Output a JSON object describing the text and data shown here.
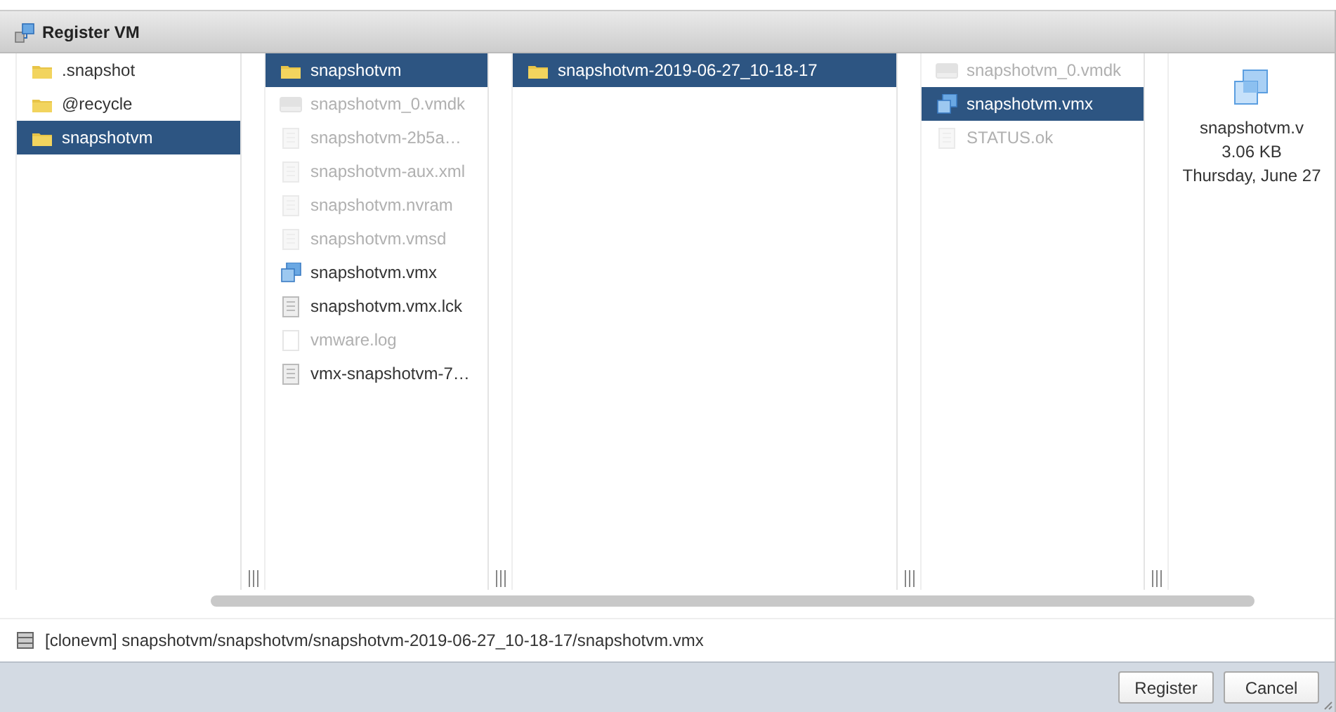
{
  "window": {
    "title": "Register VM"
  },
  "columns": [
    {
      "items": [
        {
          "label": ".snapshot",
          "kind": "folder",
          "disabled": false,
          "selected": false
        },
        {
          "label": "@recycle",
          "kind": "folder",
          "disabled": false,
          "selected": false
        },
        {
          "label": "snapshotvm",
          "kind": "folder",
          "disabled": false,
          "selected": true
        }
      ]
    },
    {
      "items": [
        {
          "label": "snapshotvm",
          "kind": "folder",
          "disabled": false,
          "selected": true
        },
        {
          "label": "snapshotvm_0.vmdk",
          "kind": "disk",
          "disabled": true,
          "selected": false
        },
        {
          "label": "snapshotvm-2b5a…",
          "kind": "file",
          "disabled": true,
          "selected": false
        },
        {
          "label": "snapshotvm-aux.xml",
          "kind": "file",
          "disabled": true,
          "selected": false
        },
        {
          "label": "snapshotvm.nvram",
          "kind": "file",
          "disabled": true,
          "selected": false
        },
        {
          "label": "snapshotvm.vmsd",
          "kind": "file",
          "disabled": true,
          "selected": false
        },
        {
          "label": "snapshotvm.vmx",
          "kind": "vmx",
          "disabled": false,
          "selected": false
        },
        {
          "label": "snapshotvm.vmx.lck",
          "kind": "file",
          "disabled": false,
          "selected": false
        },
        {
          "label": "vmware.log",
          "kind": "log",
          "disabled": true,
          "selected": false
        },
        {
          "label": "vmx-snapshotvm-7…",
          "kind": "file",
          "disabled": false,
          "selected": false
        }
      ]
    },
    {
      "items": [
        {
          "label": "snapshotvm-2019-06-27_10-18-17",
          "kind": "folder",
          "disabled": false,
          "selected": true
        }
      ]
    },
    {
      "items": [
        {
          "label": "snapshotvm_0.vmdk",
          "kind": "disk",
          "disabled": true,
          "selected": false
        },
        {
          "label": "snapshotvm.vmx",
          "kind": "vmx",
          "disabled": false,
          "selected": true
        },
        {
          "label": "STATUS.ok",
          "kind": "file",
          "disabled": true,
          "selected": false
        }
      ]
    }
  ],
  "preview": {
    "name": "snapshotvm.v",
    "size": "3.06 KB",
    "date": "Thursday, June 27"
  },
  "path": "[clonevm] snapshotvm/snapshotvm/snapshotvm-2019-06-27_10-18-17/snapshotvm.vmx",
  "buttons": [
    {
      "label": "Register"
    },
    {
      "label": "Cancel"
    }
  ]
}
